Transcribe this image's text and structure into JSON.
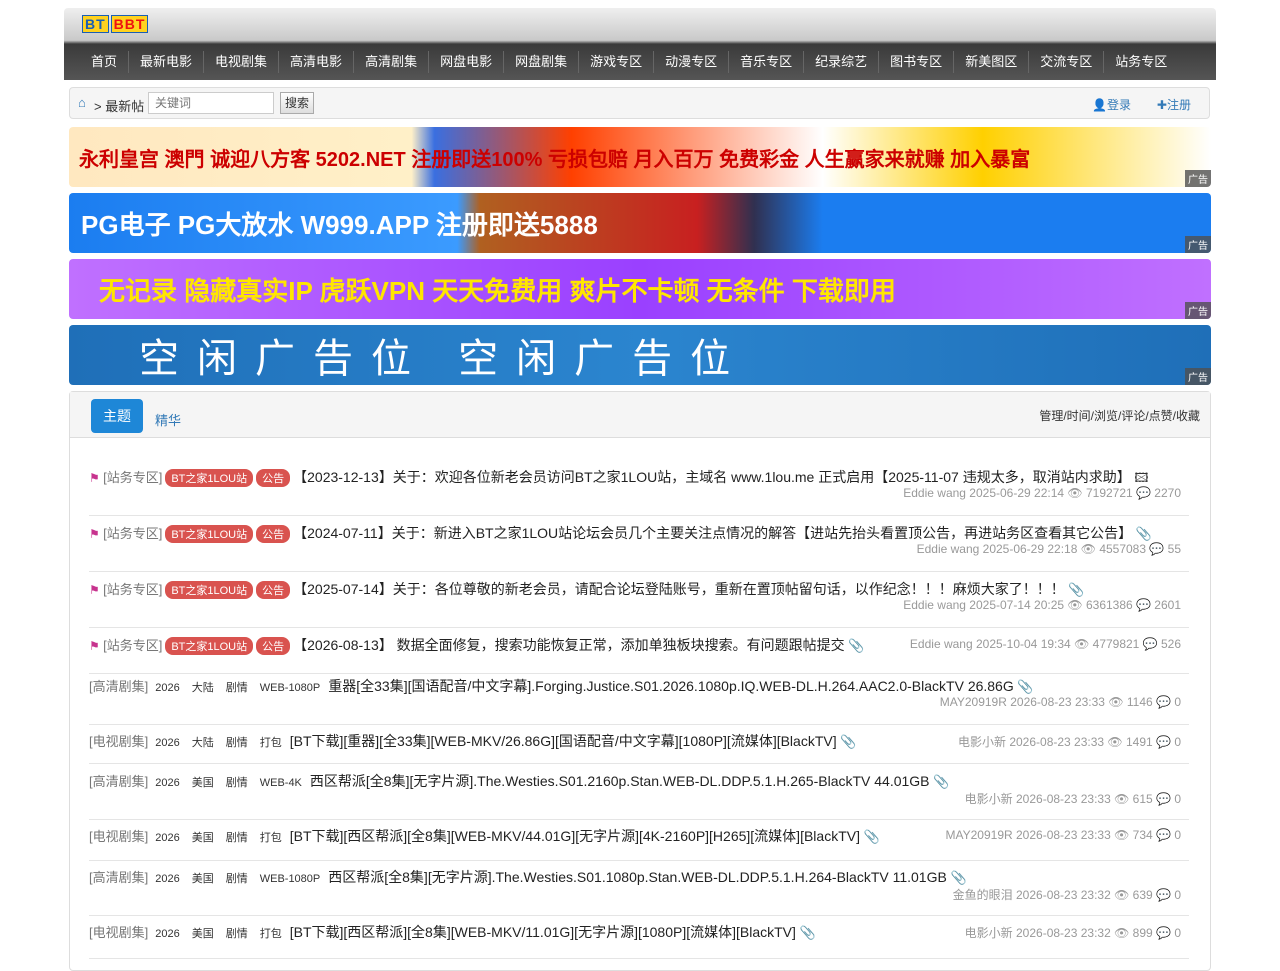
{
  "header": {
    "logo": [
      "BT",
      "BBT"
    ],
    "nav": [
      "首页",
      "最新电影",
      "电视剧集",
      "高清电影",
      "高清剧集",
      "网盘电影",
      "网盘剧集",
      "游戏专区",
      "动漫专区",
      "音乐专区",
      "纪录综艺",
      "图书专区",
      "新美图区",
      "交流专区",
      "站务专区"
    ]
  },
  "breadcrumb": {
    "current": "> 最新帖",
    "search_placeholder": "关键词",
    "search_button": "搜索",
    "login": "登录",
    "register": "注册"
  },
  "ads": {
    "tag": "广告",
    "ad1": "永利皇宫 澳門 诚迎八方客 5202.NET 注册即送100% 亏损包赔 月入百万 免费彩金 人生赢家来就赚 加入暴富",
    "ad2": "PG电子 PG大放水 W999.APP 注册即送5888",
    "ad3": "无记录 隐藏真实IP 虎跃VPN 天天免费用 爽片不卡顿 无条件 下载即用",
    "ad4": "空闲广告位  空闲广告位"
  },
  "panel": {
    "tab_active": "主题",
    "tab2": "精华",
    "sortlinks": "管理/时间/浏览/评论/点赞/收藏"
  },
  "threads": [
    {
      "cat": "[站务专区]",
      "badges": [
        "BT之家1LOU站",
        "公告"
      ],
      "tags": [],
      "title": "【2023-12-13】关于：欢迎各位新老会员访问BT之家1LOU站，主域名 www.1lou.me 正式启用【2025-11-07 违规太多，取消站内求助】",
      "author": "Eddie wang",
      "time": "2025-06-29 22:14",
      "views": "7192721",
      "comments": "2270",
      "pinned": true
    },
    {
      "cat": "[站务专区]",
      "badges": [
        "BT之家1LOU站",
        "公告"
      ],
      "tags": [],
      "title": "【2024-07-11】关于：新进入BT之家1LOU站论坛会员几个主要关注点情况的解答【进站先抬头看置顶公告，再进站务区查看其它公告】",
      "author": "Eddie wang",
      "time": "2025-06-29 22:18",
      "views": "4557083",
      "comments": "55",
      "pinned": true
    },
    {
      "cat": "[站务专区]",
      "badges": [
        "BT之家1LOU站",
        "公告"
      ],
      "tags": [],
      "title": "【2025-07-14】关于：各位尊敬的新老会员，请配合论坛登陆账号，重新在置顶帖留句话，以作纪念！！！麻烦大家了！！！",
      "author": "Eddie wang",
      "time": "2025-07-14 20:25",
      "views": "6361386",
      "comments": "2601",
      "pinned": true
    },
    {
      "cat": "[站务专区]",
      "badges": [
        "BT之家1LOU站",
        "公告"
      ],
      "tags": [],
      "title": "【2026-08-13】 数据全面修复，搜索功能恢复正常，添加单独板块搜索。有问题跟帖提交",
      "author": "Eddie wang",
      "time": "2025-10-04 19:34",
      "views": "4779821",
      "comments": "526",
      "pinned": true
    },
    {
      "cat": "[高清剧集]",
      "badges": [],
      "tags": [
        "2026",
        "大陆",
        "剧情",
        "WEB-1080P"
      ],
      "title": "重器[全33集][国语配音/中文字幕].Forging.Justice.S01.2026.1080p.IQ.WEB-DL.H.264.AAC2.0-BlackTV 26.86G",
      "author": "MAY20919R",
      "time": "2026-08-23 23:33",
      "views": "1146",
      "comments": "0",
      "pinned": false
    },
    {
      "cat": "[电视剧集]",
      "badges": [],
      "tags": [
        "2026",
        "大陆",
        "剧情",
        "打包"
      ],
      "title": "[BT下载][重器][全33集][WEB-MKV/26.86G][国语配音/中文字幕][1080P][流媒体][BlackTV]",
      "author": "电影小新",
      "time": "2026-08-23 23:33",
      "views": "1491",
      "comments": "0",
      "pinned": false
    },
    {
      "cat": "[高清剧集]",
      "badges": [],
      "tags": [
        "2026",
        "美国",
        "剧情",
        "WEB-4K"
      ],
      "title": "西区帮派[全8集][无字片源].The.Westies.S01.2160p.Stan.WEB-DL.DDP.5.1.H.265-BlackTV 44.01GB",
      "author": "电影小新",
      "time": "2026-08-23 23:33",
      "views": "615",
      "comments": "0",
      "pinned": false
    },
    {
      "cat": "[电视剧集]",
      "badges": [],
      "tags": [
        "2026",
        "美国",
        "剧情",
        "打包"
      ],
      "title": "[BT下载][西区帮派][全8集][WEB-MKV/44.01G][无字片源][4K-2160P][H265][流媒体][BlackTV]",
      "author": "MAY20919R",
      "time": "2026-08-23 23:33",
      "views": "734",
      "comments": "0",
      "pinned": false
    },
    {
      "cat": "[高清剧集]",
      "badges": [],
      "tags": [
        "2026",
        "美国",
        "剧情",
        "WEB-1080P"
      ],
      "title": "西区帮派[全8集][无字片源].The.Westies.S01.1080p.Stan.WEB-DL.DDP.5.1.H.264-BlackTV 11.01GB",
      "author": "金鱼的眼泪",
      "time": "2026-08-23 23:32",
      "views": "639",
      "comments": "0",
      "pinned": false
    },
    {
      "cat": "[电视剧集]",
      "badges": [],
      "tags": [
        "2026",
        "美国",
        "剧情",
        "打包"
      ],
      "title": "[BT下载][西区帮派][全8集][WEB-MKV/11.01G][无字片源][1080P][流媒体][BlackTV]",
      "author": "电影小新",
      "time": "2026-08-23 23:32",
      "views": "899",
      "comments": "0",
      "pinned": false
    }
  ]
}
